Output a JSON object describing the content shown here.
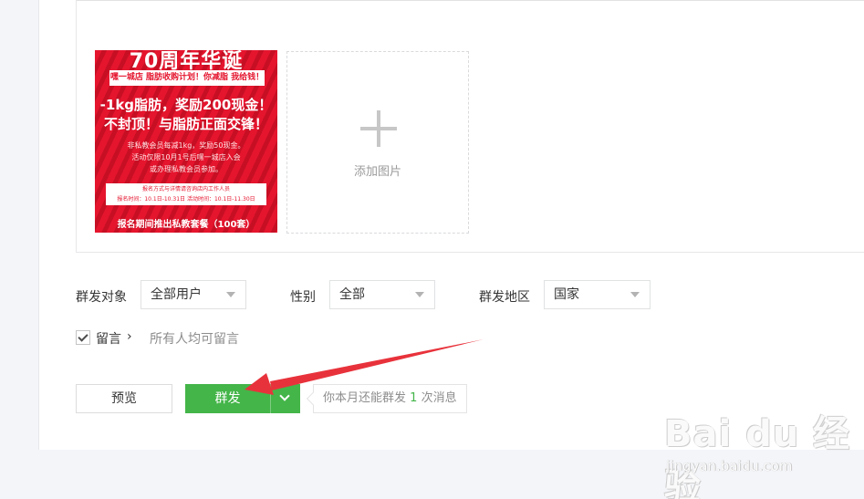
{
  "poster": {
    "title": "70周年华诞",
    "banner": "嘿一城店 脂肪收购计划！你减脂 我给钱！",
    "line1": "-1kg脂肪，奖励200现金！",
    "line2": "不封顶！与脂肪正面交锋！",
    "desc1": "非私教会员每减1kg，奖励50现金。",
    "desc2": "活动仅限10月1号后嘿一城店入会",
    "desc3": "或办理私教会员参加。",
    "box1": "报名方式与详情请咨询店内工作人员",
    "box2": "报名时间：10.1日-10.31日    活动时间：10.1日-11.30日",
    "footer": "报名期间推出私教套餐（100套）"
  },
  "add_image": {
    "label": "添加图片"
  },
  "filters": {
    "target": {
      "label": "群发对象",
      "value": "全部用户"
    },
    "gender": {
      "label": "性别",
      "value": "全部"
    },
    "region": {
      "label": "群发地区",
      "value": "国家"
    }
  },
  "comment": {
    "label": "留言",
    "chevron": "›",
    "note": "所有人均可留言"
  },
  "actions": {
    "preview": "预览",
    "send": "群发",
    "quota_prefix": "你本月还能群发",
    "quota_count": "1",
    "quota_suffix": "次消息"
  },
  "watermark": {
    "line1": "Bai du 经验",
    "line2": "jingyan.baidu.com"
  },
  "colors": {
    "accent_green": "#44b549",
    "poster_red": "#e5152e",
    "annotation_red": "#e8323b"
  }
}
